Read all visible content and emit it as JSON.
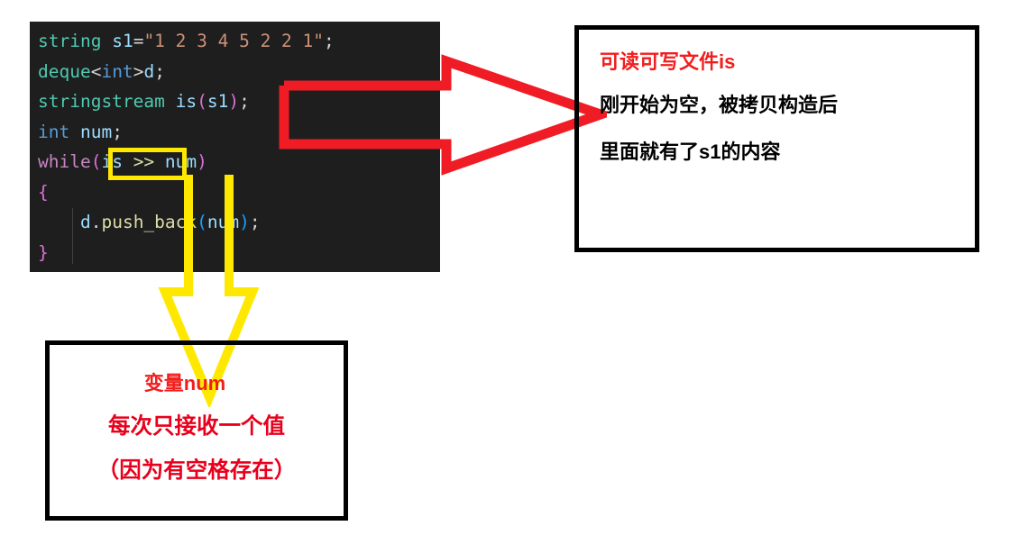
{
  "code_block": {
    "language": "cpp",
    "background_color": "#1e1e1e",
    "lines": [
      {
        "id": "line-1",
        "tokens": [
          {
            "text": "string",
            "kind": "type"
          },
          {
            "text": " ",
            "kind": "plain"
          },
          {
            "text": "s1",
            "kind": "var"
          },
          {
            "text": "=",
            "kind": "op"
          },
          {
            "text": "\"1 2 3 4 5 2 2 1\"",
            "kind": "string"
          },
          {
            "text": ";",
            "kind": "punc"
          }
        ]
      },
      {
        "id": "line-2",
        "tokens": [
          {
            "text": "deque",
            "kind": "type"
          },
          {
            "text": "<",
            "kind": "op"
          },
          {
            "text": "int",
            "kind": "keyword2"
          },
          {
            "text": ">",
            "kind": "op"
          },
          {
            "text": "d",
            "kind": "var"
          },
          {
            "text": ";",
            "kind": "punc"
          }
        ]
      },
      {
        "id": "line-3",
        "tokens": [
          {
            "text": "stringstream",
            "kind": "type"
          },
          {
            "text": " ",
            "kind": "plain"
          },
          {
            "text": "is",
            "kind": "var"
          },
          {
            "text": "(",
            "kind": "paren1"
          },
          {
            "text": "s1",
            "kind": "var"
          },
          {
            "text": ")",
            "kind": "paren1"
          },
          {
            "text": ";",
            "kind": "punc"
          }
        ]
      },
      {
        "id": "line-4",
        "tokens": [
          {
            "text": "int",
            "kind": "keyword2"
          },
          {
            "text": " ",
            "kind": "plain"
          },
          {
            "text": "num",
            "kind": "var"
          },
          {
            "text": ";",
            "kind": "punc"
          }
        ]
      },
      {
        "id": "line-5",
        "tokens": [
          {
            "text": "while",
            "kind": "keyword"
          },
          {
            "text": "(",
            "kind": "paren1"
          },
          {
            "text": "is",
            "kind": "var"
          },
          {
            "text": " ",
            "kind": "plain"
          },
          {
            "text": ">>",
            "kind": "fn"
          },
          {
            "text": " ",
            "kind": "plain"
          },
          {
            "text": "num",
            "kind": "var"
          },
          {
            "text": ")",
            "kind": "paren1"
          }
        ]
      },
      {
        "id": "line-6",
        "tokens": [
          {
            "text": "{",
            "kind": "brace"
          }
        ]
      },
      {
        "id": "line-7",
        "tokens": [
          {
            "text": "    ",
            "kind": "plain"
          },
          {
            "text": "d",
            "kind": "var"
          },
          {
            "text": ".",
            "kind": "punc"
          },
          {
            "text": "push_back",
            "kind": "fn"
          },
          {
            "text": "(",
            "kind": "paren2"
          },
          {
            "text": "num",
            "kind": "var"
          },
          {
            "text": ")",
            "kind": "paren2"
          },
          {
            "text": ";",
            "kind": "punc"
          }
        ]
      },
      {
        "id": "line-8",
        "tokens": [
          {
            "text": "}",
            "kind": "brace"
          }
        ]
      }
    ]
  },
  "annotations": {
    "yellow_highlight": {
      "target_text": "is >> num",
      "color": "#ffe800"
    },
    "red_arrow": {
      "color": "#f01c25",
      "direction": "right",
      "from": "stringstream is(s1);",
      "to": "right-box"
    },
    "yellow_arrow": {
      "color": "#ffe800",
      "direction": "down",
      "from": "is >> num",
      "to": "bottom-box"
    },
    "right_box": {
      "border_color": "#000000",
      "title": "可读可写文件is",
      "title_color": "#f21d1d",
      "lines": [
        "刚开始为空，被拷贝构造后",
        "里面就有了s1的内容"
      ],
      "lines_color": "#000000"
    },
    "bottom_box": {
      "border_color": "#000000",
      "title": "变量num",
      "title_color": "#f21d1d",
      "lines": [
        "每次只接收一个值",
        "（因为有空格存在）"
      ],
      "lines_color": "#e8001c"
    }
  }
}
